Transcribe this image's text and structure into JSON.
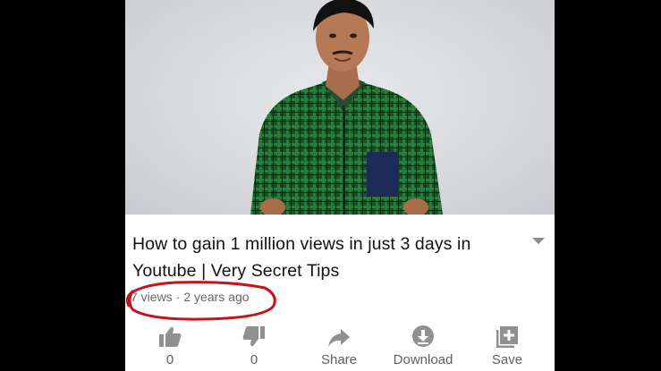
{
  "video": {
    "title": "How to gain 1 million views in just 3 days in Youtube | Very Secret Tips",
    "views": "7 views",
    "separator": "·",
    "age": "2 years ago"
  },
  "actions": {
    "like_count": "0",
    "dislike_count": "0",
    "share_label": "Share",
    "download_label": "Download",
    "save_label": "Save"
  },
  "icons": {
    "like": "thumbs-up-icon",
    "dislike": "thumbs-down-icon",
    "share": "share-arrow-icon",
    "download": "download-circle-icon",
    "save": "add-to-playlist-icon",
    "expand": "chevron-down-icon"
  },
  "colors": {
    "highlight_circle": "#c4141c",
    "icon_gray": "#909090",
    "shirt_green": "#1f5a2e"
  }
}
